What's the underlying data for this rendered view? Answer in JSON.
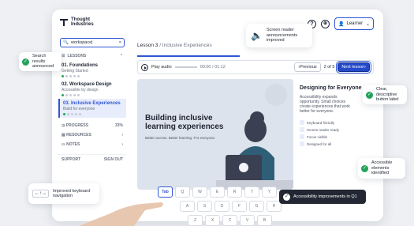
{
  "app": {
    "logo_line1": "Thought",
    "logo_line2": "Industries"
  },
  "header": {
    "help_icon": "?",
    "learner_label": "Learner"
  },
  "sidebar": {
    "search_value": "workspace|",
    "lessons_header": "LESSONS",
    "items": [
      {
        "number_title": "01. Foundations",
        "subtitle": "Getting Started"
      },
      {
        "number_title": "02. Workspace Design",
        "subtitle": "Accessible by design"
      },
      {
        "number_title": "03. Inclusive Experiences",
        "subtitle": "Build for everyone"
      }
    ],
    "progress_label": "PROGRESS",
    "progress_value": "33%",
    "resources_label": "RESOURCES",
    "notes_label": "NOTES",
    "support_label": "SUPPORT",
    "signout_label": "SIGN OUT"
  },
  "content": {
    "breadcrumb_lesson": "Lesson 3",
    "breadcrumb_title": " / Inclusive Experiences",
    "audio_label": "Play audio",
    "audio_time": "00:00 / 01:12",
    "previous_label": "Previous",
    "page_count": "2 of 5",
    "next_label": "Next lesson",
    "hero_title": "Building inclusive learning experiences",
    "hero_sub": "Better access. Better learning. For everyone.",
    "side_title": "Designing for Everyone",
    "side_body": "Accessibility expands opportunity. Small choices create experiences that work better for everyone.",
    "chips": [
      "Keyboard friendly",
      "Screen reader ready",
      "Focus visible",
      "Designed for all"
    ]
  },
  "callouts": {
    "screen_reader": "Screen reader announcements improved",
    "search_results": "Search results announced",
    "clear_button": "Clear, descriptive button label",
    "elements_identified": "Accessible elements identified",
    "keyboard_nav": "Improved keyboard navigation"
  },
  "toast": {
    "text": "Accessibility improvements in Q1"
  },
  "keyboard": {
    "keys": [
      "Tab",
      "Q",
      "W",
      "E",
      "R",
      "T",
      "Y",
      "A",
      "S",
      "D",
      "F",
      "G",
      "H",
      "Z",
      "X",
      "C",
      "V",
      "B"
    ]
  },
  "colors": {
    "accent": "#2f55d4",
    "success": "#22a35a",
    "toast_bg": "#222733"
  }
}
